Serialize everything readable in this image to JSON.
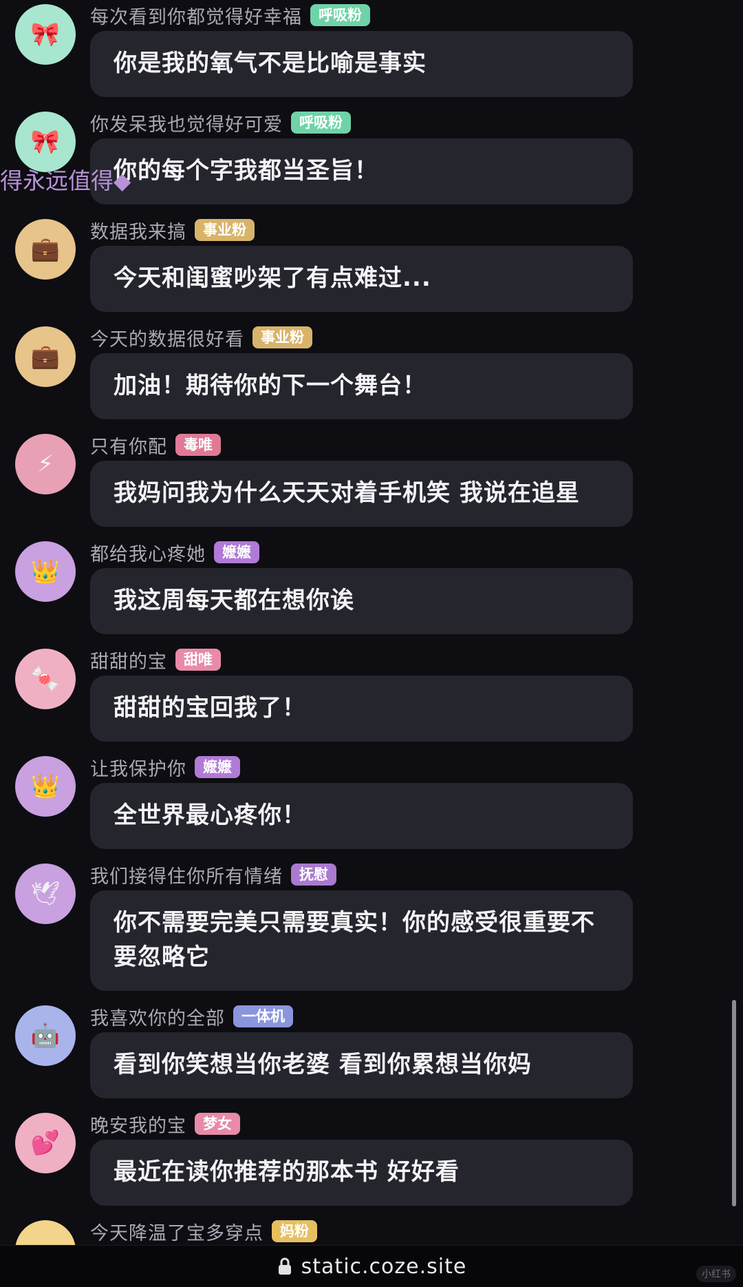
{
  "overflow_text": "得永远值得◆",
  "messages": [
    {
      "nickname": "每次看到你都觉得好幸福",
      "badge": "呼吸粉",
      "text": "你是我的氧气不是比喻是事实",
      "avatar_icon": "flower-icon",
      "avatar_glyph": "🎀",
      "avatar_color": "#a8e6cf",
      "badge_color": "#6fd3a8"
    },
    {
      "nickname": "你发呆我也觉得好可爱",
      "badge": "呼吸粉",
      "text": "你的每个字我都当圣旨！",
      "avatar_icon": "flower-icon",
      "avatar_glyph": "🎀",
      "avatar_color": "#a8e6cf",
      "badge_color": "#6fd3a8"
    },
    {
      "nickname": "数据我来搞",
      "badge": "事业粉",
      "text": "今天和闺蜜吵架了有点难过...",
      "avatar_icon": "briefcase-icon",
      "avatar_glyph": "💼",
      "avatar_color": "#e6c48a",
      "badge_color": "#d8b46a"
    },
    {
      "nickname": "今天的数据很好看",
      "badge": "事业粉",
      "text": "加油！期待你的下一个舞台！",
      "avatar_icon": "briefcase-icon",
      "avatar_glyph": "💼",
      "avatar_color": "#e6c48a",
      "badge_color": "#d8b46a"
    },
    {
      "nickname": "只有你配",
      "badge": "毒唯",
      "text": "我妈问我为什么天天对着手机笑 我说在追星",
      "avatar_icon": "lightning-icon",
      "avatar_glyph": "⚡",
      "avatar_color": "#e8a0b4",
      "badge_color": "#e07a96"
    },
    {
      "nickname": "都给我心疼她",
      "badge": "嬷嬷",
      "text": "我这周每天都在想你诶",
      "avatar_icon": "crown-icon",
      "avatar_glyph": "👑",
      "avatar_color": "#c9a0e0",
      "badge_color": "#b07ad6"
    },
    {
      "nickname": "甜甜的宝",
      "badge": "甜唯",
      "text": "甜甜的宝回我了！",
      "avatar_icon": "candy-icon",
      "avatar_glyph": "🍬",
      "avatar_color": "#f0b0c4",
      "badge_color": "#e88aa8"
    },
    {
      "nickname": "让我保护你",
      "badge": "嬷嬷",
      "text": "全世界最心疼你！",
      "avatar_icon": "crown-icon",
      "avatar_glyph": "👑",
      "avatar_color": "#c9a0e0",
      "badge_color": "#b07ad6"
    },
    {
      "nickname": "我们接得住你所有情绪",
      "badge": "抚慰",
      "text": "你不需要完美只需要真实！你的感受很重要不要忽略它",
      "avatar_icon": "dove-icon",
      "avatar_glyph": "🕊",
      "avatar_color": "#c9a0e0",
      "badge_color": "#a97ad0"
    },
    {
      "nickname": "我喜欢你的全部",
      "badge": "一体机",
      "text": "看到你笑想当你老婆 看到你累想当你妈",
      "avatar_icon": "robot-icon",
      "avatar_glyph": "🤖",
      "avatar_color": "#a9b4ea",
      "badge_color": "#8a96dc"
    },
    {
      "nickname": "晚安我的宝",
      "badge": "梦女",
      "text": "最近在读你推荐的那本书 好好看",
      "avatar_icon": "hearts-icon",
      "avatar_glyph": "💕",
      "avatar_color": "#f0b0c4",
      "badge_color": "#e88aa8"
    },
    {
      "nickname": "今天降温了宝多穿点",
      "badge": "妈粉",
      "text": "",
      "avatar_icon": "sun-icon",
      "avatar_glyph": "",
      "avatar_color": "#f2d48a",
      "badge_color": "#e6c060"
    }
  ],
  "bottom_bar": {
    "url": "static.coze.site",
    "lock_icon": "lock-icon"
  },
  "watermark": "小红书"
}
